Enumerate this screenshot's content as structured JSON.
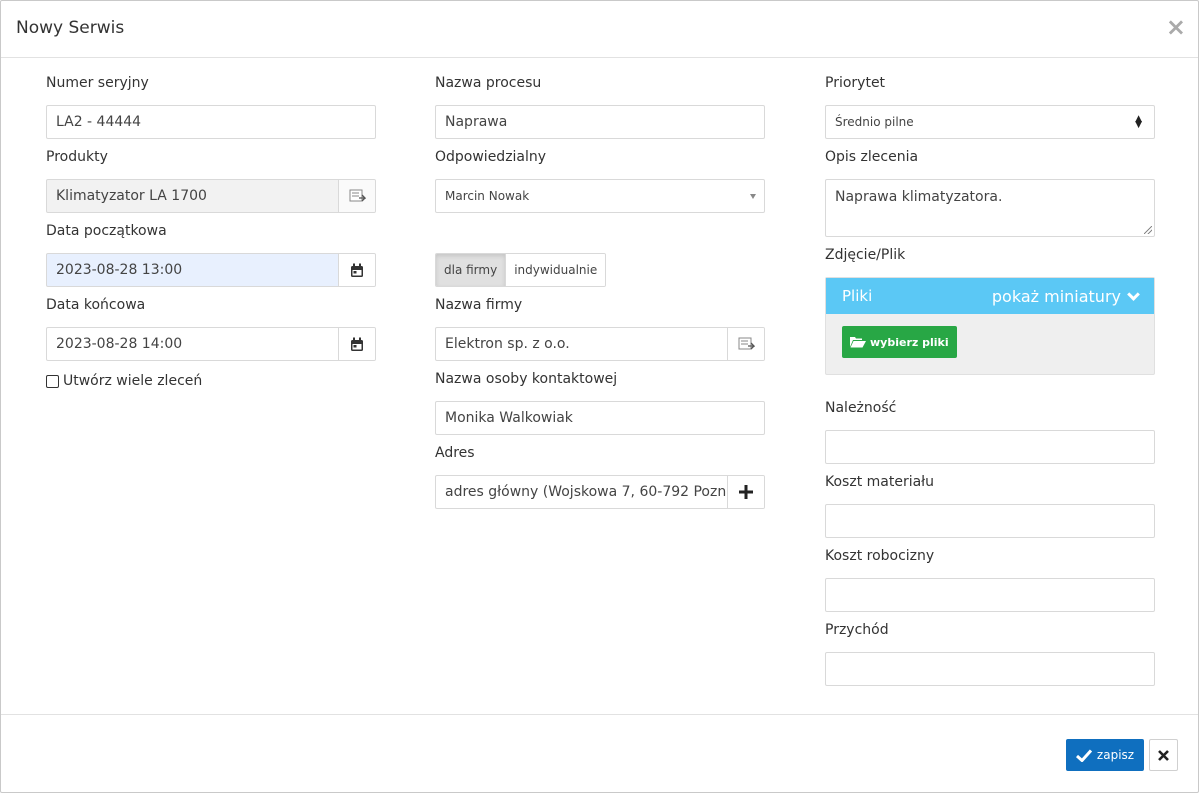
{
  "modal": {
    "title": "Nowy Serwis",
    "close_symbol": "×"
  },
  "col1": {
    "serial_label": "Numer seryjny",
    "serial_value": "LA2 - 44444",
    "products_label": "Produkty",
    "products_value": "Klimatyzator LA 1700",
    "start_label": "Data początkowa",
    "start_value": "2023-08-28 13:00",
    "end_label": "Data końcowa",
    "end_value": "2023-08-28 14:00",
    "multi_label": "Utwórz wiele zleceń"
  },
  "col2": {
    "process_label": "Nazwa procesu",
    "process_value": "Naprawa",
    "responsible_label": "Odpowiedzialny",
    "responsible_value": "Marcin Nowak",
    "toggle_company": "dla firmy",
    "toggle_individual": "indywidualnie",
    "company_label": "Nazwa firmy",
    "company_value": "Elektron sp. z o.o.",
    "contact_label": "Nazwa osoby kontaktowej",
    "contact_value": "Monika Walkowiak",
    "address_label": "Adres",
    "address_value": "adres główny (Wojskowa 7, 60-792 Pozn"
  },
  "col3": {
    "priority_label": "Priorytet",
    "priority_value": "Średnio pilne",
    "description_label": "Opis zlecenia",
    "description_value": "Naprawa klimatyzatora.",
    "file_label": "Zdjęcie/Plik",
    "files_title": "Pliki",
    "files_toggle": "pokaż miniatury",
    "choose_files": "wybierz pliki",
    "due_label": "Należność",
    "material_label": "Koszt materiału",
    "labor_label": "Koszt robocizny",
    "income_label": "Przychód"
  },
  "footer": {
    "save_label": "zapisz"
  },
  "icons": [
    "close-icon",
    "list-picker-icon",
    "calendar-icon",
    "dropdown-caret-icon",
    "updown-icon",
    "plus-icon",
    "chevron-down-icon",
    "folder-open-icon",
    "check-icon",
    "cancel-icon"
  ],
  "colors": {
    "files_header": "#5bc8f5",
    "choose_button": "#28a745",
    "save_button": "#0f6fbf",
    "highlight_input": "#e8f0fe"
  }
}
